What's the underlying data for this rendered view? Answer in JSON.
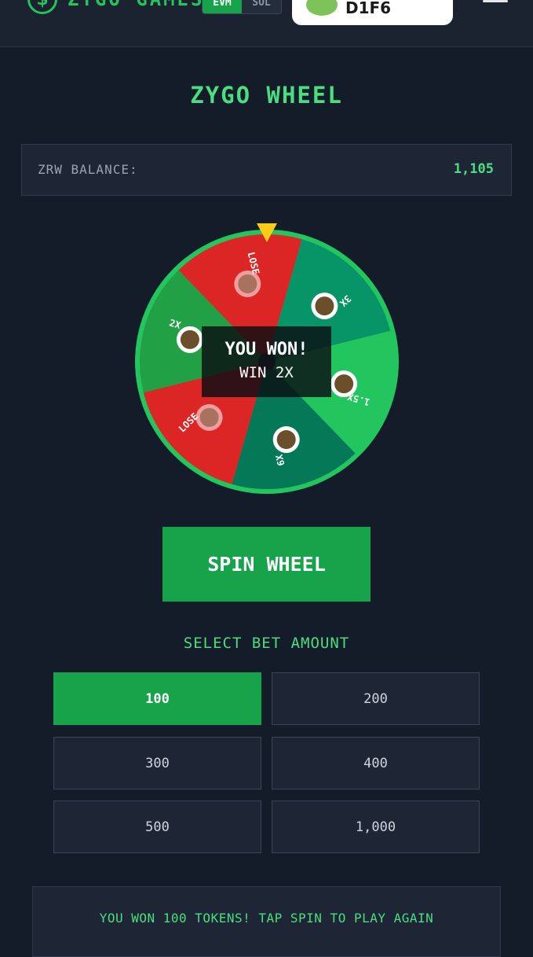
{
  "header": {
    "logo_icon": "dollar-coin-icon",
    "app_name": "ZYGO GAMES",
    "chains": [
      {
        "label": "EVM",
        "active": true
      },
      {
        "label": "SOL",
        "active": false
      }
    ],
    "wallet": {
      "address": "D1F6"
    },
    "menu_icon": "hamburger-menu-icon"
  },
  "page": {
    "title": "ZYGO WHEEL"
  },
  "balance": {
    "label": "ZRW BALANCE:",
    "value": "1,105"
  },
  "wheel": {
    "segments": [
      {
        "label": "2X",
        "color": "#22a045"
      },
      {
        "label": "LOSE",
        "color": "#dc2626"
      },
      {
        "label": "3X",
        "color": "#079466"
      },
      {
        "label": "1.5X",
        "color": "#22c55e"
      },
      {
        "label": "6X",
        "color": "#047857"
      },
      {
        "label": "LOSE",
        "color": "#dc2626"
      }
    ],
    "rim_color": "#22c55e",
    "pointer_color": "#facc15"
  },
  "result": {
    "title": "YOU WON!",
    "subtitle": "WIN 2X"
  },
  "spin_button": {
    "label": "SPIN WHEEL"
  },
  "bet": {
    "label": "SELECT BET AMOUNT",
    "options": [
      "100",
      "200",
      "300",
      "400",
      "500",
      "1,000"
    ],
    "selected": "100"
  },
  "status": {
    "message": "YOU WON 100 TOKENS! TAP SPIN TO PLAY AGAIN"
  },
  "colors": {
    "accent": "#22c55e",
    "background": "#141b29",
    "panel": "#1e2635"
  }
}
